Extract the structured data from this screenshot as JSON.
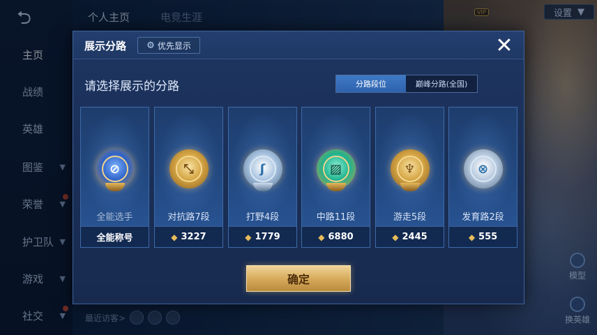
{
  "background": {
    "back_icon": "back-arrow-icon",
    "top_tabs": [
      "个人主页",
      "电竞生涯"
    ],
    "vip_label": "VIP",
    "settings_label": "设置",
    "nav_items": [
      {
        "label": "主页",
        "has_chevron": false,
        "active": true
      },
      {
        "label": "战绩",
        "has_chevron": false
      },
      {
        "label": "英雄",
        "has_chevron": false
      },
      {
        "label": "图鉴",
        "has_chevron": true
      },
      {
        "label": "荣誉",
        "has_chevron": true,
        "badge": true
      },
      {
        "label": "护卫队",
        "has_chevron": true
      },
      {
        "label": "游戏",
        "has_chevron": true
      },
      {
        "label": "社交",
        "has_chevron": true,
        "badge": true
      }
    ],
    "recent_visitors_label": "最近访客>",
    "model_label": "模型",
    "swap_hero_label": "换英雄"
  },
  "dialog": {
    "title": "展示分路",
    "priority_label": "优先显示",
    "close_icon": "close-icon",
    "prompt": "请选择展示的分路",
    "segment": {
      "options": [
        "分路段位",
        "巅峰分路(全国)"
      ],
      "selected": 0
    },
    "cards": [
      {
        "name": "全能选手",
        "footer": "全能称号",
        "icon": "all-round-emblem-icon",
        "has_power_icon": false
      },
      {
        "name": "对抗路7段",
        "footer": "3227",
        "icon": "clash-lane-emblem-icon",
        "has_power_icon": true
      },
      {
        "name": "打野4段",
        "footer": "1779",
        "icon": "jungle-emblem-icon",
        "has_power_icon": true
      },
      {
        "name": "中路11段",
        "footer": "6880",
        "icon": "mid-lane-emblem-icon",
        "has_power_icon": true
      },
      {
        "name": "游走5段",
        "footer": "2445",
        "icon": "roam-emblem-icon",
        "has_power_icon": true
      },
      {
        "name": "发育路2段",
        "footer": "555",
        "icon": "farm-lane-emblem-icon",
        "has_power_icon": true
      }
    ],
    "confirm_label": "确定",
    "colors": {
      "accent_gold": "#d7ac5c",
      "segment_active": "#3f79c6",
      "panel_bg": "#1a2f57"
    }
  }
}
